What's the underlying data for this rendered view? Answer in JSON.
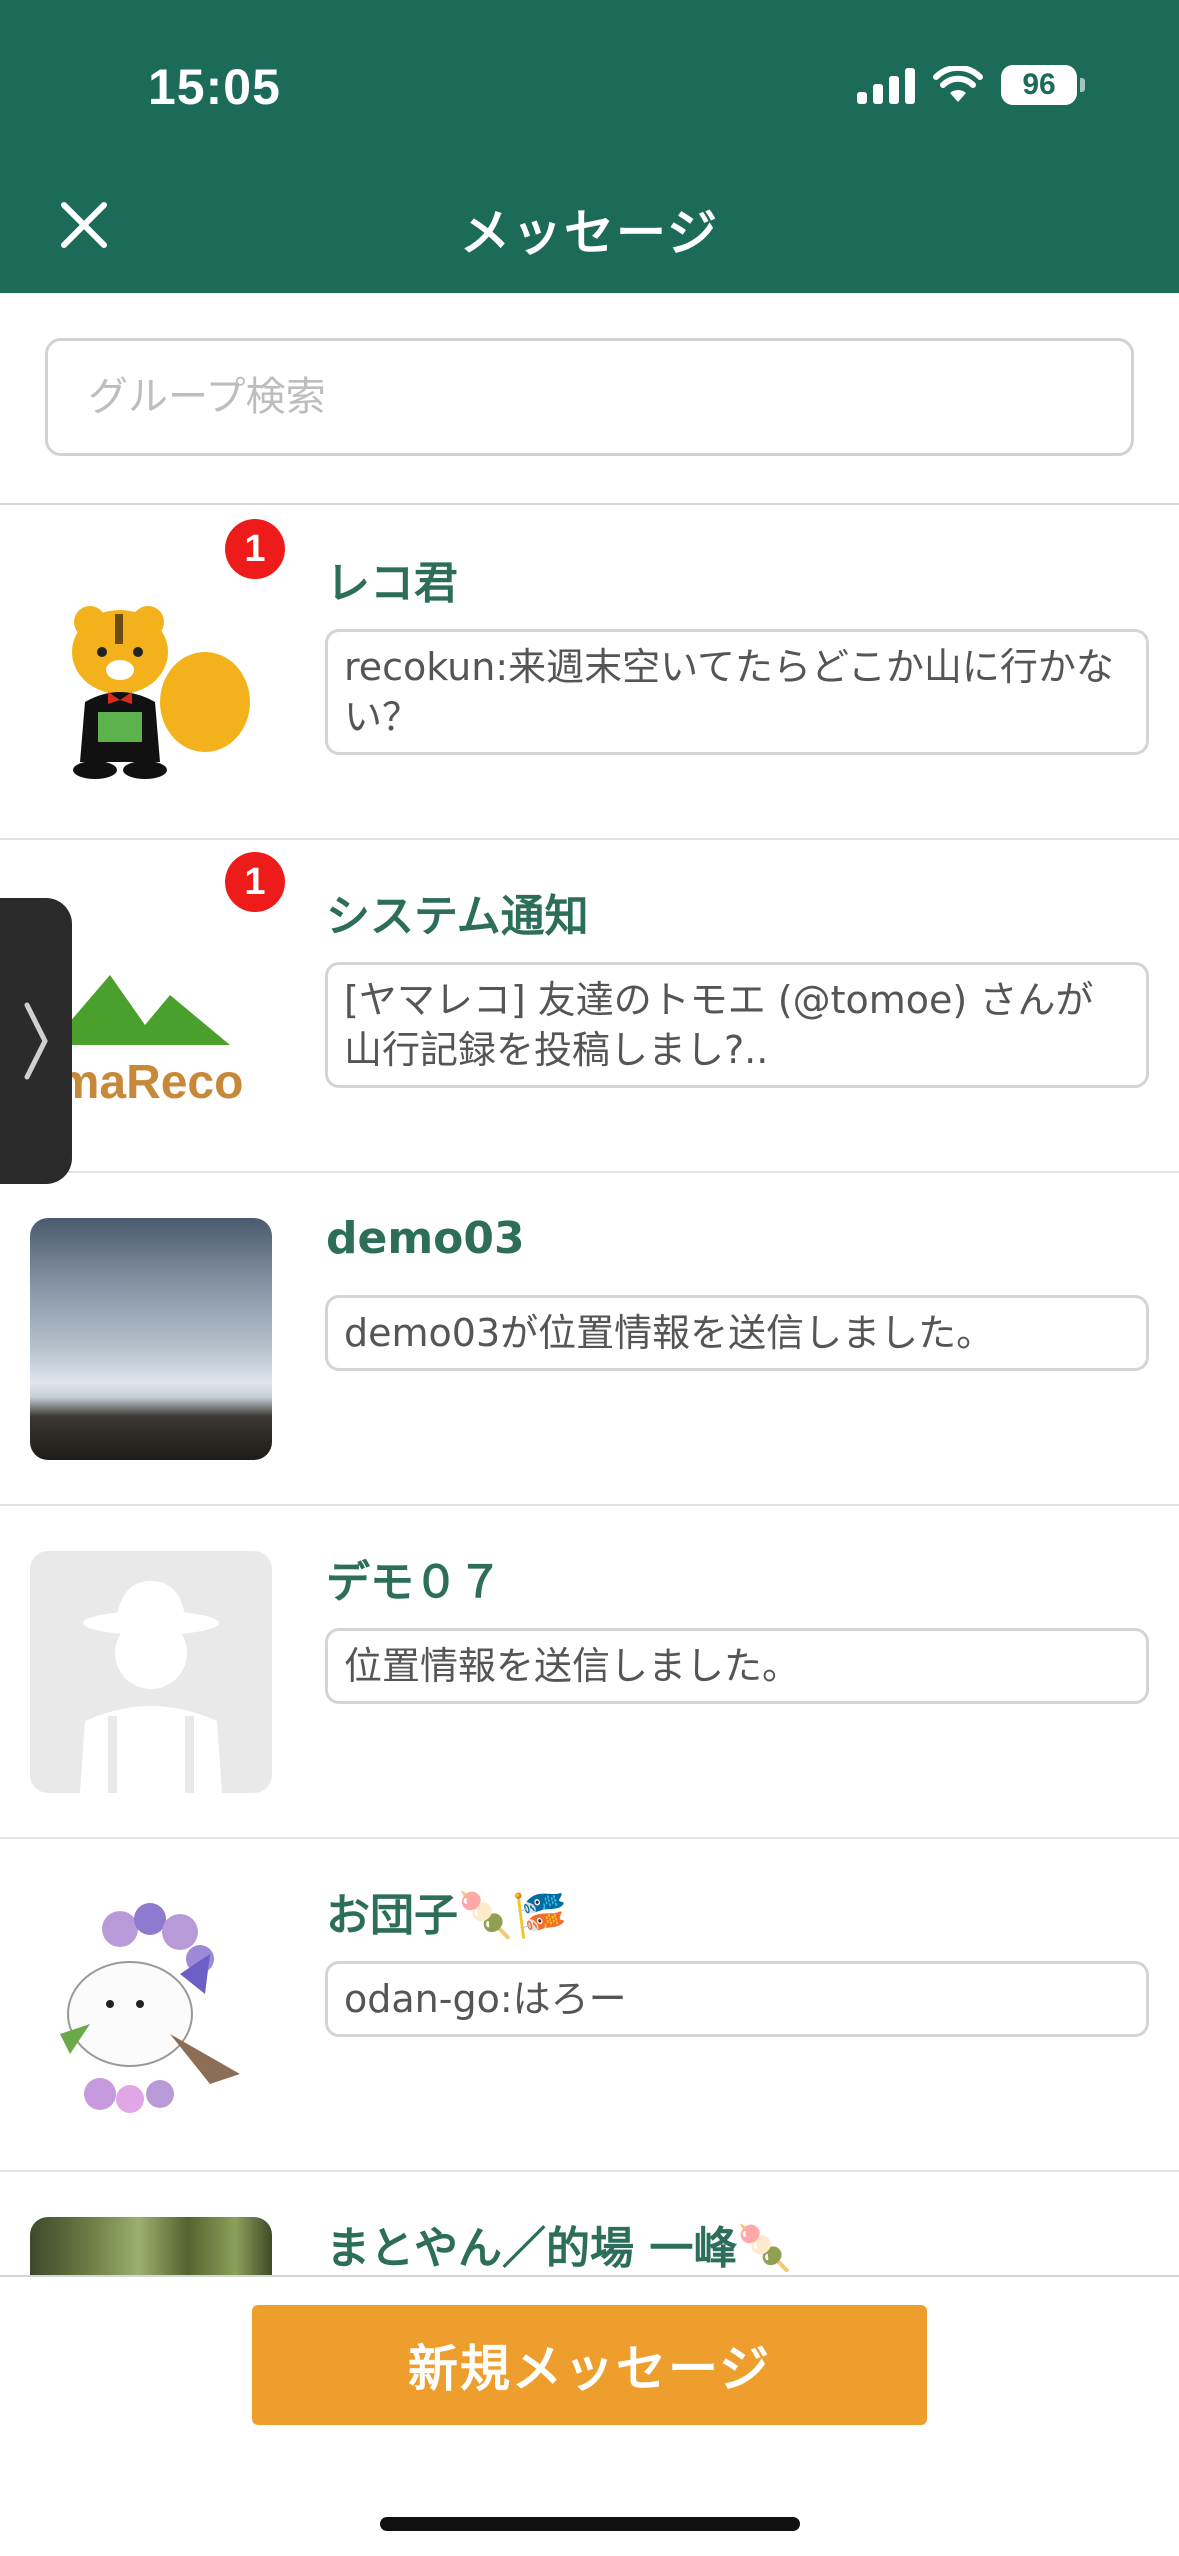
{
  "status_bar": {
    "time": "15:05",
    "battery": "96"
  },
  "header": {
    "title": "メッセージ"
  },
  "search": {
    "placeholder": "グループ検索",
    "value": ""
  },
  "threads": [
    {
      "name": "レコ君",
      "preview": "recokun:来週末空いてたらどこか山に行かない？",
      "unread": "1",
      "avatar": "squirrel-mascot"
    },
    {
      "name": "システム通知",
      "preview": "[ヤマレコ]  友達のトモエ (@tomoe) さんが山行記録を投稿しまし?..",
      "unread": "1",
      "avatar_text": "amaReco"
    },
    {
      "name": "demo03",
      "preview": "demo03が位置情報を送信しました。",
      "avatar": "sea-of-clouds-photo"
    },
    {
      "name": "デモ０７",
      "preview": "位置情報を送信しました。",
      "avatar": "default-hiker"
    },
    {
      "name": "お団子🍡🎏",
      "preview": "odan-go:はろー",
      "avatar": "bird-with-flowers"
    },
    {
      "name": "まとやん／的場 一峰🍡",
      "preview": "",
      "avatar": "forest-photo"
    }
  ],
  "footer": {
    "new_message_label": "新規メッセージ"
  },
  "colors": {
    "header": "#1c6b58",
    "accent": "#ee9e2c",
    "name_text": "#2d6e5a",
    "badge": "#ee1b1b"
  }
}
